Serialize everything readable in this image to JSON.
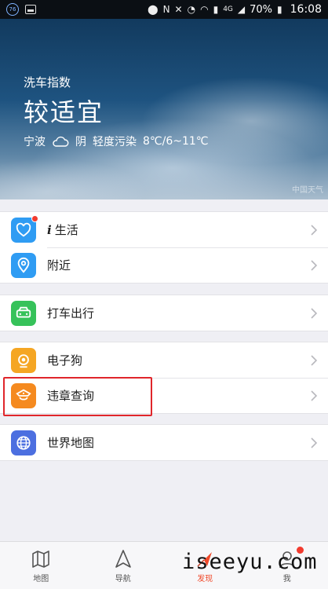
{
  "status_bar": {
    "badge": "76",
    "battery": "70%",
    "time": "16:08",
    "network": "4G"
  },
  "weather": {
    "index_label": "洗车指数",
    "level": "较适宜",
    "city": "宁波",
    "condition": "阴",
    "pollution": "轻度污染",
    "temperature": "8℃/6~11℃",
    "corner_mark": "中国天气"
  },
  "menu": {
    "life": {
      "prefix": "i",
      "label": "生活",
      "color": "#2f9cf3",
      "has_badge": true
    },
    "nearby": {
      "label": "附近",
      "color": "#2f9cf3"
    },
    "taxi": {
      "label": "打车出行",
      "color": "#36c25a"
    },
    "camera": {
      "label": "电子狗",
      "color": "#f5a623"
    },
    "violation": {
      "label": "违章查询",
      "color": "#f58a1f",
      "highlighted": true
    },
    "worldmap": {
      "label": "世界地图",
      "color": "#4c6fe0"
    }
  },
  "tabs": [
    {
      "label": "地图",
      "icon": "map-icon",
      "active": false
    },
    {
      "label": "导航",
      "icon": "navigation-arrow-icon",
      "active": false
    },
    {
      "label": "发现",
      "icon": "discover-icon",
      "active": true
    },
    {
      "label": "我",
      "icon": "user-icon",
      "active": false,
      "has_badge": true
    }
  ],
  "watermark": "iseeyu.com",
  "colors": {
    "accent": "#f04a2b",
    "highlight_border": "#e0262b",
    "badge": "#f23b2f"
  }
}
